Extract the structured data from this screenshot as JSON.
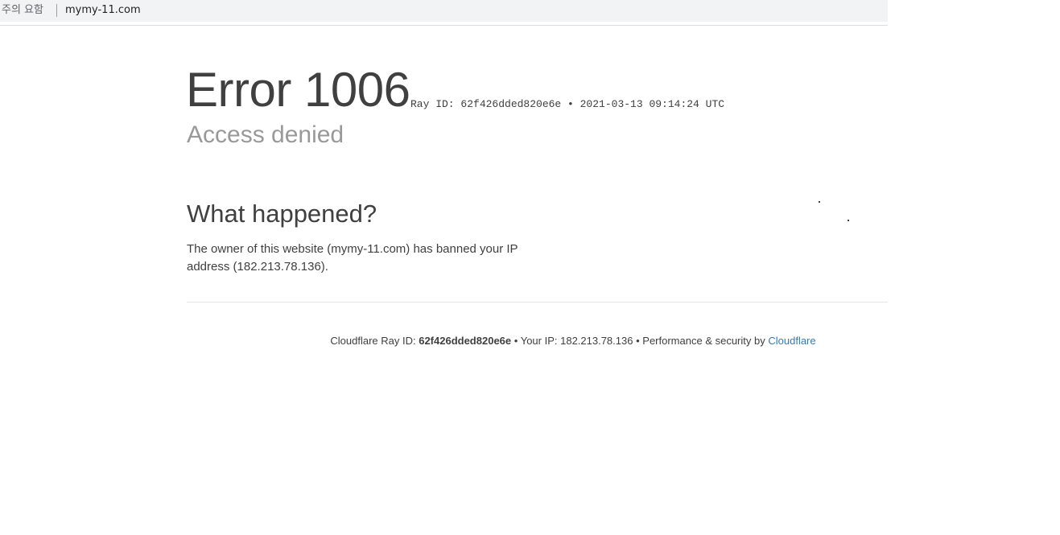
{
  "browser": {
    "security_warning": "주의 요함",
    "url": "mymy-11.com"
  },
  "error": {
    "title": "Error 1006",
    "ray_meta": "Ray ID: 62f426dded820e6e • 2021-03-13 09:14:24 UTC",
    "subtitle": "Access denied"
  },
  "section": {
    "heading": "What happened?",
    "body": "The owner of this website (mymy-11.com) has banned your IP address (182.213.78.136)."
  },
  "footer": {
    "ray_prefix": "Cloudflare Ray ID:",
    "ray_id": "62f426dded820e6e",
    "bullet1": "•",
    "ip_text": "Your IP: 182.213.78.136",
    "bullet2": "•",
    "perf_text": "Performance & security by",
    "link_label": "Cloudflare"
  }
}
